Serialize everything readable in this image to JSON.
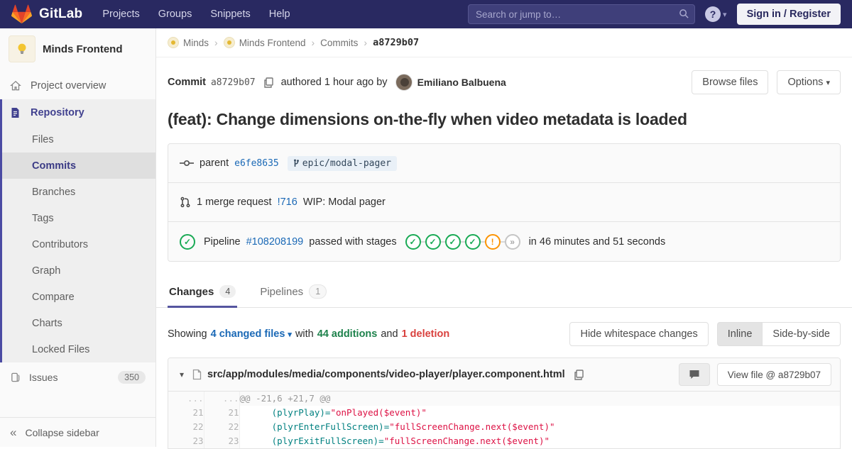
{
  "header": {
    "logo_text": "GitLab",
    "nav": [
      "Projects",
      "Groups",
      "Snippets",
      "Help"
    ],
    "search_placeholder": "Search or jump to…",
    "help_glyph": "?",
    "sign_in_label": "Sign in / Register"
  },
  "icons": {
    "caret_down": "▾",
    "chevron_down": "▾",
    "collapse": "«",
    "crumb_sep": "›",
    "gutter_dots": "..."
  },
  "sidebar": {
    "project_name": "Minds Frontend",
    "overview_label": "Project overview",
    "repository_label": "Repository",
    "repo_items": [
      "Files",
      "Commits",
      "Branches",
      "Tags",
      "Contributors",
      "Graph",
      "Compare",
      "Charts",
      "Locked Files"
    ],
    "issues_label": "Issues",
    "issues_count": "350",
    "collapse_label": "Collapse sidebar"
  },
  "breadcrumb": {
    "group": "Minds",
    "project": "Minds Frontend",
    "section": "Commits",
    "current": "a8729b07"
  },
  "commit": {
    "label": "Commit",
    "sha": "a8729b07",
    "authored_text": "authored 1 hour ago by",
    "author": "Emiliano Balbuena",
    "browse_files_label": "Browse files",
    "options_label": "Options",
    "title": "(feat): Change dimensions on-the-fly when video metadata is loaded",
    "parent_label": "parent",
    "parent_sha": "e6fe8635",
    "branch": "epic/modal-pager",
    "mr_text": "1 merge request",
    "mr_id": "!716",
    "mr_title": "WIP: Modal pager",
    "pipeline_label": "Pipeline",
    "pipeline_id": "#108208199",
    "pipeline_status_text": "passed with stages",
    "pipeline_time_text": "in 46 minutes and 51 seconds",
    "pipeline_stages": [
      {
        "glyph": "✓",
        "status": "success"
      },
      {
        "glyph": "✓",
        "status": "success"
      },
      {
        "glyph": "✓",
        "status": "success"
      },
      {
        "glyph": "✓",
        "status": "success"
      },
      {
        "glyph": "!",
        "status": "warning"
      },
      {
        "glyph": "»",
        "status": "skipped"
      }
    ]
  },
  "tabs": [
    {
      "label": "Changes",
      "count": "4"
    },
    {
      "label": "Pipelines",
      "count": "1"
    }
  ],
  "diff": {
    "showing_text": "Showing",
    "changed_files_text": "4 changed files",
    "with_text": "with",
    "additions_text": "44 additions",
    "and_text": "and",
    "deletions_text": "1 deletion",
    "hide_whitespace_label": "Hide whitespace changes",
    "inline_label": "Inline",
    "side_by_side_label": "Side-by-side",
    "file_path": "src/app/modules/media/components/video-player/player.component.html",
    "view_file_label": "View file @ a8729b07",
    "hunk_header": "@@ -21,6 +21,7 @@",
    "lines": [
      {
        "old": "21",
        "new": "21",
        "code_attr": "      (plyrPlay)=",
        "code_str": "\"onPlayed($event)\""
      },
      {
        "old": "22",
        "new": "22",
        "code_attr": "      (plyrEnterFullScreen)=",
        "code_str": "\"fullScreenChange.next($event)\""
      },
      {
        "old": "23",
        "new": "23",
        "code_attr": "      (plyrExitFullScreen)=",
        "code_str": "\"fullScreenChange.next($event)\""
      }
    ]
  },
  "colors": {
    "navbar_bg": "#292961",
    "accent_indigo": "#4b4ba3",
    "link_blue": "#1b69b6",
    "success_green": "#1aaa55",
    "warning_orange": "#fc9403"
  }
}
